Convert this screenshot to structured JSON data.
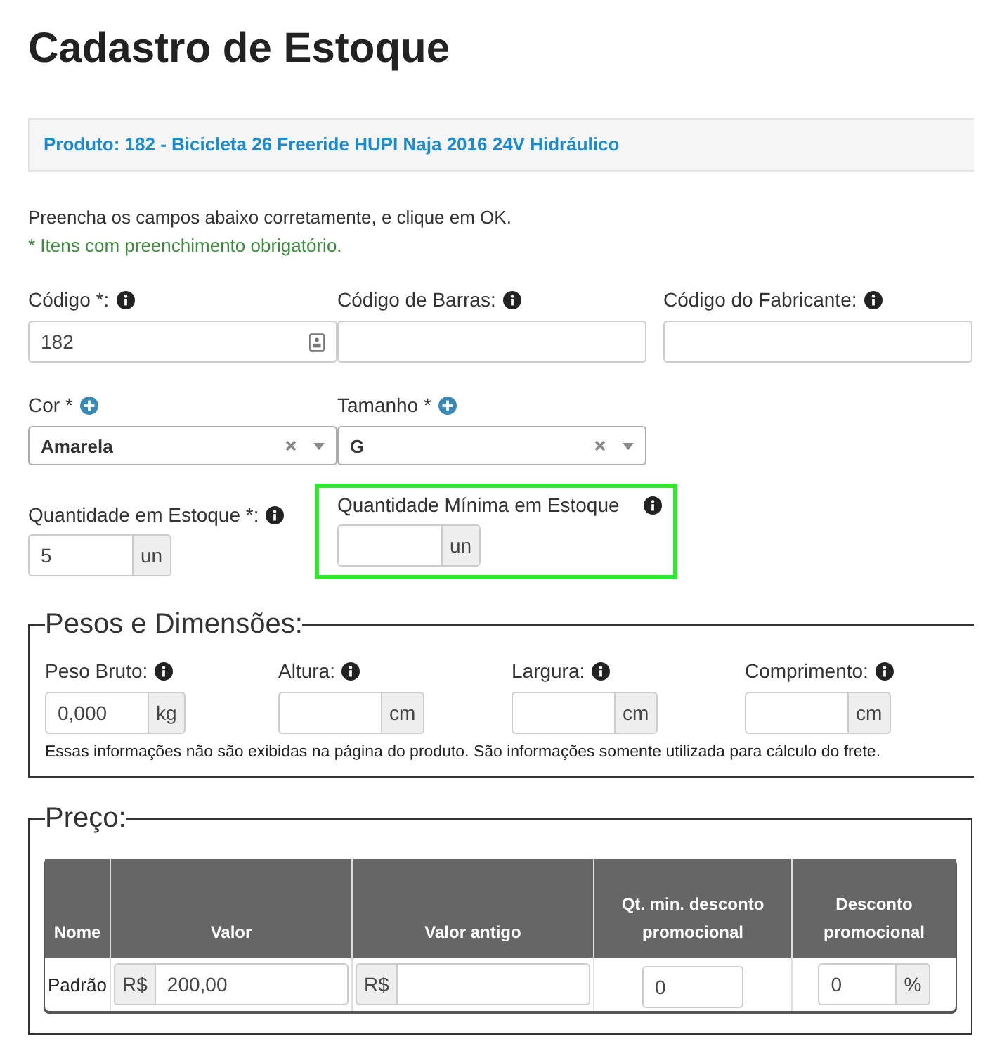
{
  "title": "Cadastro de Estoque",
  "product_banner": "Produto: 182 - Bicicleta 26 Freeride HUPI Naja 2016 24V Hidráulico",
  "instructions": "Preencha os campos abaixo corretamente, e clique em OK.",
  "required_note": "* Itens com preenchimento obrigatório.",
  "code_fields": [
    {
      "label": "Código *:",
      "value": "182",
      "widget": true
    },
    {
      "label": "Código de Barras:",
      "widget": false
    },
    {
      "label": "Código do Fabricante:",
      "widget": false
    }
  ],
  "selects": [
    {
      "label": "Cor *",
      "value": "Amarela"
    },
    {
      "label": "Tamanho *",
      "value": "G"
    }
  ],
  "quantities": [
    {
      "label": "Quantidade em Estoque *:",
      "value": "5",
      "unit": "un",
      "highlighted": false
    },
    {
      "label": "Quantidade Mínima em Estoque",
      "unit": "un",
      "highlighted": true
    }
  ],
  "weights": {
    "legend": "Pesos e Dimensões:",
    "fields": [
      {
        "label": "Peso Bruto:",
        "value": "0,000",
        "unit": "kg"
      },
      {
        "label": "Altura:",
        "unit": "cm"
      },
      {
        "label": "Largura:",
        "unit": "cm"
      },
      {
        "label": "Comprimento:",
        "unit": "cm"
      }
    ],
    "note": "Essas informações não são exibidas na página do produto. São informações somente utilizada para cálculo do frete."
  },
  "price": {
    "legend": "Preço:",
    "columns": [
      "Nome",
      "Valor",
      "Valor antigo",
      "Qt. min. desconto promocional",
      "Desconto promocional"
    ],
    "rows": [
      {
        "name": "Padrão",
        "value_prefix": "R$",
        "value": "200,00",
        "old_prefix": "R$",
        "min_qty": "0",
        "discount": "0",
        "discount_suffix": "%"
      }
    ]
  }
}
